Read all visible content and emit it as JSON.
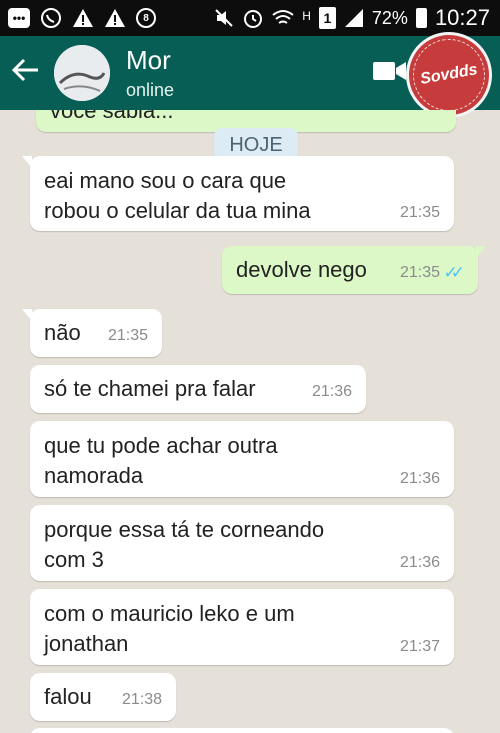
{
  "status_bar": {
    "battery": "72%",
    "time": "10:27",
    "sim_slot": "1",
    "network": "H",
    "icons": [
      "bbm-icon",
      "whatsapp-icon",
      "warning-icon",
      "warning-icon",
      "messenger-icon",
      "mute-icon",
      "alarm-icon",
      "wifi-icon",
      "signal-icon",
      "battery-icon"
    ]
  },
  "header": {
    "contact_name": "Mor",
    "contact_status": "online",
    "watermark": "Sovdds"
  },
  "chat": {
    "previous_preview": "voce sabia...",
    "date_chip": "HOJE",
    "messages": [
      {
        "dir": "in",
        "text": "eai mano sou o cara que\nrobou o celular da tua mina",
        "time": "21:35"
      },
      {
        "dir": "out",
        "text": "devolve nego",
        "time": "21:35",
        "ticks": "✓✓"
      },
      {
        "dir": "in",
        "text": "não",
        "time": "21:35"
      },
      {
        "dir": "in",
        "text": "só te chamei pra falar",
        "time": "21:36"
      },
      {
        "dir": "in",
        "text": "que tu pode achar outra\nnamorada",
        "time": "21:36"
      },
      {
        "dir": "in",
        "text": "porque essa tá te corneando\ncom 3",
        "time": "21:36"
      },
      {
        "dir": "in",
        "text": "com o mauricio leko e um\njonathan",
        "time": "21:37"
      },
      {
        "dir": "in",
        "text": "falou",
        "time": "21:38"
      }
    ]
  },
  "colors": {
    "header": "#075e54",
    "outgoing_bubble": "#dcf8c6",
    "incoming_bubble": "#ffffff",
    "chat_background": "#e6e1d8"
  }
}
